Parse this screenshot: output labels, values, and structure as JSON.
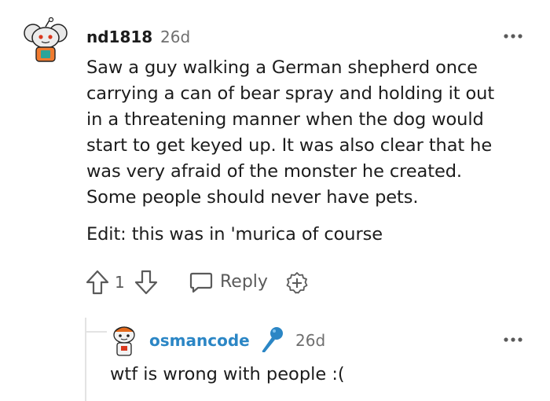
{
  "comment": {
    "username": "nd1818",
    "age": "26d",
    "avatar_icon": "snoo-avatar-icon",
    "more_icon": "more-options-icon",
    "body_lines": [
      "Saw a guy walking a German shepherd once",
      "carrying a can of bear spray and holding it out",
      "in a threatening manner when the dog would",
      "start to get keyed up. It was also clear that he",
      "was very afraid of the monster he created.",
      "Some people should never have pets."
    ],
    "edit": "Edit: this was in 'murica of course",
    "votes": "1",
    "reply_label": "Reply",
    "icons": [
      "upvote-icon",
      "downvote-icon",
      "reply-bubble-icon",
      "award-add-icon"
    ]
  },
  "reply": {
    "username": "osmancode",
    "age": "26d",
    "flair_icon": "microphone-icon",
    "body": "wtf is wrong with people :("
  },
  "colors": {
    "username_reply": "#2b86c5",
    "muted": "#6f6f6f",
    "text": "#1c1c1c"
  }
}
